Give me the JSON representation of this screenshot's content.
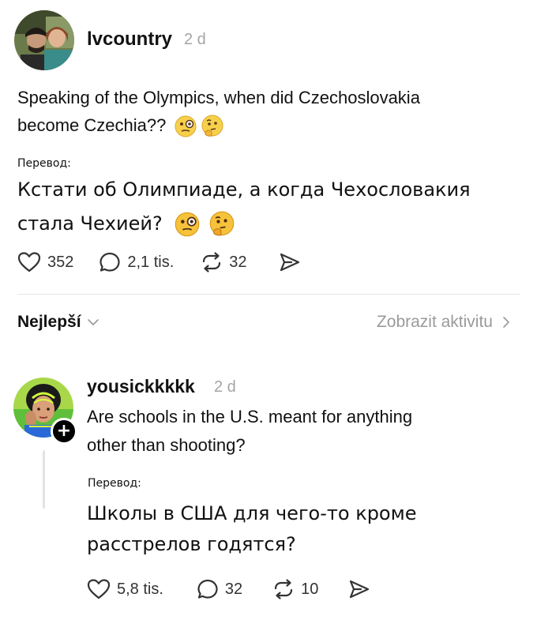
{
  "post": {
    "username": "lvcountry",
    "time": "2 d",
    "text": "Speaking of the Olympics, when did Czechoslovakia become Czechia??",
    "text_line1": "Speaking of the Olympics, when did Czechoslovakia",
    "text_line2": "become Czechia??",
    "emojis": [
      "face-with-monocle-icon",
      "thinking-face-icon"
    ],
    "translation_label": "Перевод:",
    "translation_line1": "Кстати об Олимпиаде, а когда Чехословакия",
    "translation_line2": "стала Чехией?",
    "likes": "352",
    "replies": "2,1 tis.",
    "reposts": "32"
  },
  "sort": {
    "label": "Nejlepší",
    "activity": "Zobrazit aktivitu"
  },
  "reply": {
    "username": "yousickkkkk",
    "time": "2 d",
    "text_line1": "Are schools in the U.S. meant for anything",
    "text_line2": "other than shooting?",
    "translation_label": "Перевод:",
    "translation_line1": "Школы в США для чего-то кроме",
    "translation_line2": "расстрелов годятся?",
    "likes": "5,8 tis.",
    "replies": "32",
    "reposts": "10",
    "follow_symbol": "+"
  },
  "icons": {
    "like": "heart-icon",
    "reply": "speech-bubble-icon",
    "repost": "repost-arrows-icon",
    "share": "send-plane-icon"
  }
}
